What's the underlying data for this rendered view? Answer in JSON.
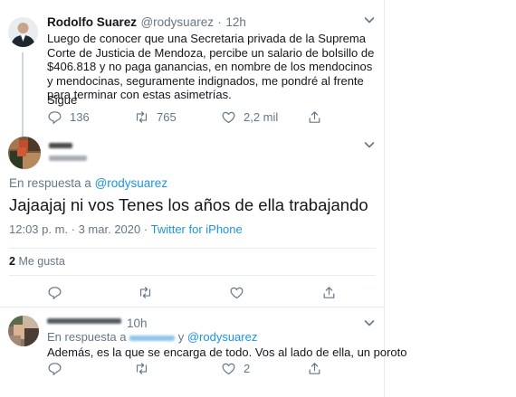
{
  "tweet1": {
    "name": "Rodolfo Suarez",
    "handle": "@rodysuarez",
    "dot": "·",
    "time": "12h",
    "text": "Luego de conocer que una Secretaria privada de la Suprema Corte de Justicia de Mendoza, percibe un salario de bolsillo de $406.818 y no paga ganancias, en nombre de los mendocinos y mendocinas, seguramente indignados, me pondré al frente para terminar con estas asimetrías.",
    "more": "Sigue",
    "replies": "136",
    "retweets": "765",
    "likes": "2,2 mil"
  },
  "tweet2": {
    "reply_prefix": "En respuesta a",
    "reply_to": "@rodysuarez",
    "text": "Jajaajaj ni vos Tenes los años de ella trabajando",
    "timestamp": "12:03 p. m. · 3 mar. 2020 ·",
    "source": "Twitter for iPhone",
    "likes_count": "2",
    "likes_label": "Me gusta"
  },
  "tweet3": {
    "time": "10h",
    "reply_prefix": "En respuesta a",
    "reply_joiner": "y",
    "reply_to": "@rodysuarez",
    "text": "Además, es la que se encarga de todo. Vos al lado de ella, un poroto",
    "likes": "2"
  },
  "icons": {
    "reply": "reply-icon",
    "retweet": "retweet-icon",
    "like": "heart-icon",
    "share": "share-icon",
    "more": "chevron-down-icon"
  },
  "colors": {
    "accent": "#1b95e0",
    "muted": "#657786",
    "divider": "#e6ecf0",
    "thread": "#ccd6dd"
  }
}
